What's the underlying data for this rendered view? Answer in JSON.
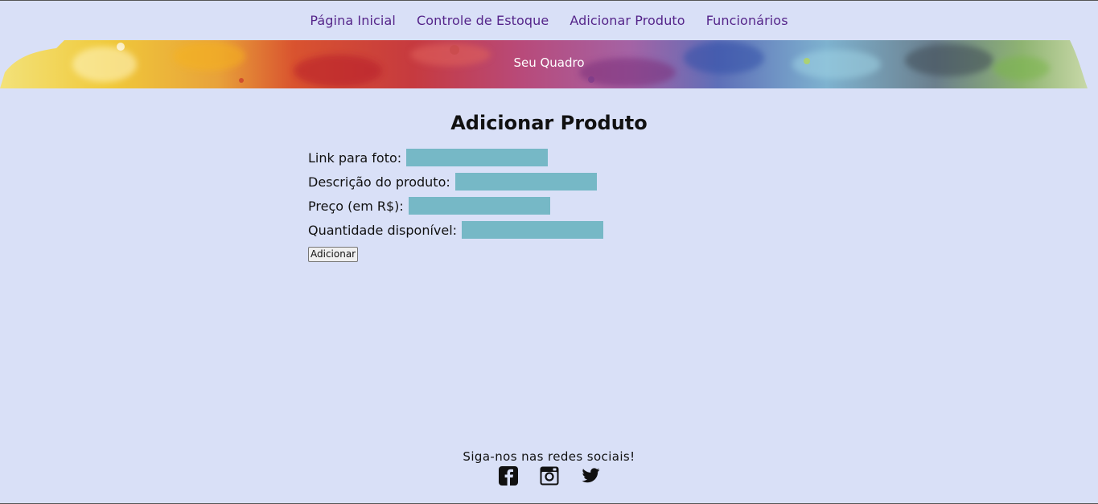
{
  "nav": {
    "items": [
      {
        "label": "Página Inicial"
      },
      {
        "label": "Controle de Estoque"
      },
      {
        "label": "Adicionar Produto"
      },
      {
        "label": "Funcionários"
      }
    ]
  },
  "banner": {
    "title": "Seu Quadro"
  },
  "main": {
    "title": "Adicionar Produto",
    "fields": [
      {
        "label": "Link para foto:",
        "value": "",
        "placeholder": ""
      },
      {
        "label": "Descrição do produto:",
        "value": "",
        "placeholder": ""
      },
      {
        "label": "Preço (em R$):",
        "value": "",
        "placeholder": ""
      },
      {
        "label": "Quantidade disponível:",
        "value": "",
        "placeholder": ""
      }
    ],
    "submit_label": "Adicionar"
  },
  "footer": {
    "text": "Siga-nos nas redes sociais!",
    "icons": [
      "facebook-icon",
      "instagram-icon",
      "twitter-icon"
    ]
  },
  "colors": {
    "background": "#d9e0f7",
    "nav_link": "#55258a",
    "input_fill": "#76b8c6"
  }
}
